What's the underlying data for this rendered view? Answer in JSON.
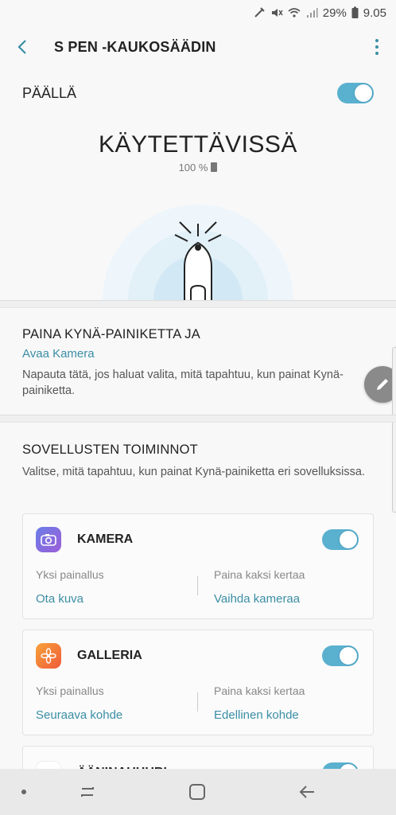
{
  "status_bar": {
    "battery_percent": "29%",
    "time": "9.05"
  },
  "app_bar": {
    "title": "S PEN -KAUKOSÄÄDIN"
  },
  "master_switch": {
    "label": "PÄÄLLÄ",
    "on": true
  },
  "status_hero": {
    "state": "KÄYTETTÄVISSÄ",
    "battery": "100 %"
  },
  "press_section": {
    "heading": "PAINA KYNÄ-PAINIKETTA JA",
    "action": "Avaa Kamera",
    "description": "Napauta tätä, jos haluat valita, mitä tapahtuu, kun painat Kynä-painiketta."
  },
  "apps_section": {
    "heading": "SOVELLUSTEN TOIMINNOT",
    "description": "Valitse, mitä tapahtuu, kun painat Kynä-painiketta eri sovelluksissa.",
    "apps": [
      {
        "name": "KAMERA",
        "icon": "camera-icon",
        "enabled": true,
        "single_label": "Yksi painallus",
        "single_value": "Ota kuva",
        "double_label": "Paina kaksi kertaa",
        "double_value": "Vaihda kameraa"
      },
      {
        "name": "GALLERIA",
        "icon": "gallery-flower-icon",
        "enabled": true,
        "single_label": "Yksi painallus",
        "single_value": "Seuraava kohde",
        "double_label": "Paina kaksi kertaa",
        "double_value": "Edellinen kohde"
      },
      {
        "name": "ÄÄNINAUHURI",
        "icon": "voice-recorder-icon",
        "enabled": true
      }
    ]
  },
  "colors": {
    "accent": "#3b8ea5",
    "toggle_on": "#5ab0cf",
    "fab": "#8a8a8a",
    "background": "#f8f8f8"
  }
}
